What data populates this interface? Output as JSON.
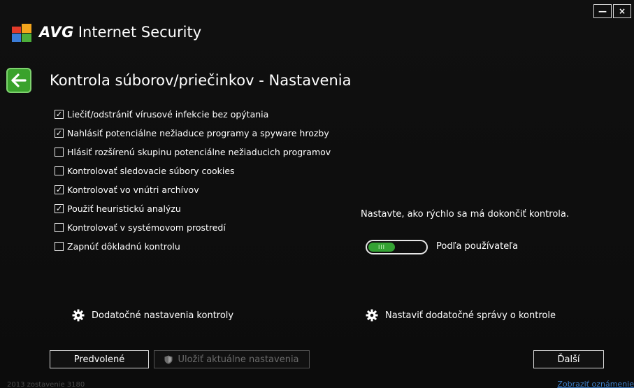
{
  "window": {
    "minimize_label": "—",
    "close_label": "×"
  },
  "app": {
    "brand": "AVG",
    "product": "Internet Security"
  },
  "page": {
    "back_icon": "arrow-left-icon",
    "title": "Kontrola súborov/priečinkov - Nastavenia"
  },
  "options": [
    {
      "label": "Liečiť/odstrániť vírusové infekcie bez opýtania",
      "checked": true
    },
    {
      "label": "Nahlásiť potenciálne nežiaduce programy a spyware hrozby",
      "checked": true
    },
    {
      "label": "Hlásiť rozšírenú skupinu potenciálne nežiaducich programov",
      "checked": false
    },
    {
      "label": "Kontrolovať sledovacie súbory cookies",
      "checked": false
    },
    {
      "label": "Kontrolovať vo vnútri archívov",
      "checked": true
    },
    {
      "label": "Použiť heuristickú analýzu",
      "checked": true
    },
    {
      "label": "Kontrolovať v systémovom prostredí",
      "checked": false
    },
    {
      "label": "Zapnúť dôkladnú kontrolu",
      "checked": false
    }
  ],
  "speed": {
    "title": "Nastavte, ako rýchlo sa má dokončiť kontrola.",
    "value_label": "Podľa používateľa",
    "toggle_grip": "III"
  },
  "links": {
    "additional_settings": "Dodatočné nastavenia kontroly",
    "additional_reports": "Nastaviť dodatočné správy o kontrole"
  },
  "buttons": {
    "default": "Predvolené",
    "save": "Uložiť aktuálne nastavenia",
    "next": "Ďalší"
  },
  "footer": {
    "build": "2013 zostavenie 3180",
    "notification": "Zobraziť oznámenie"
  },
  "colors": {
    "accent_green": "#34a233",
    "background": "#101010",
    "link_blue": "#3e7fc8"
  }
}
